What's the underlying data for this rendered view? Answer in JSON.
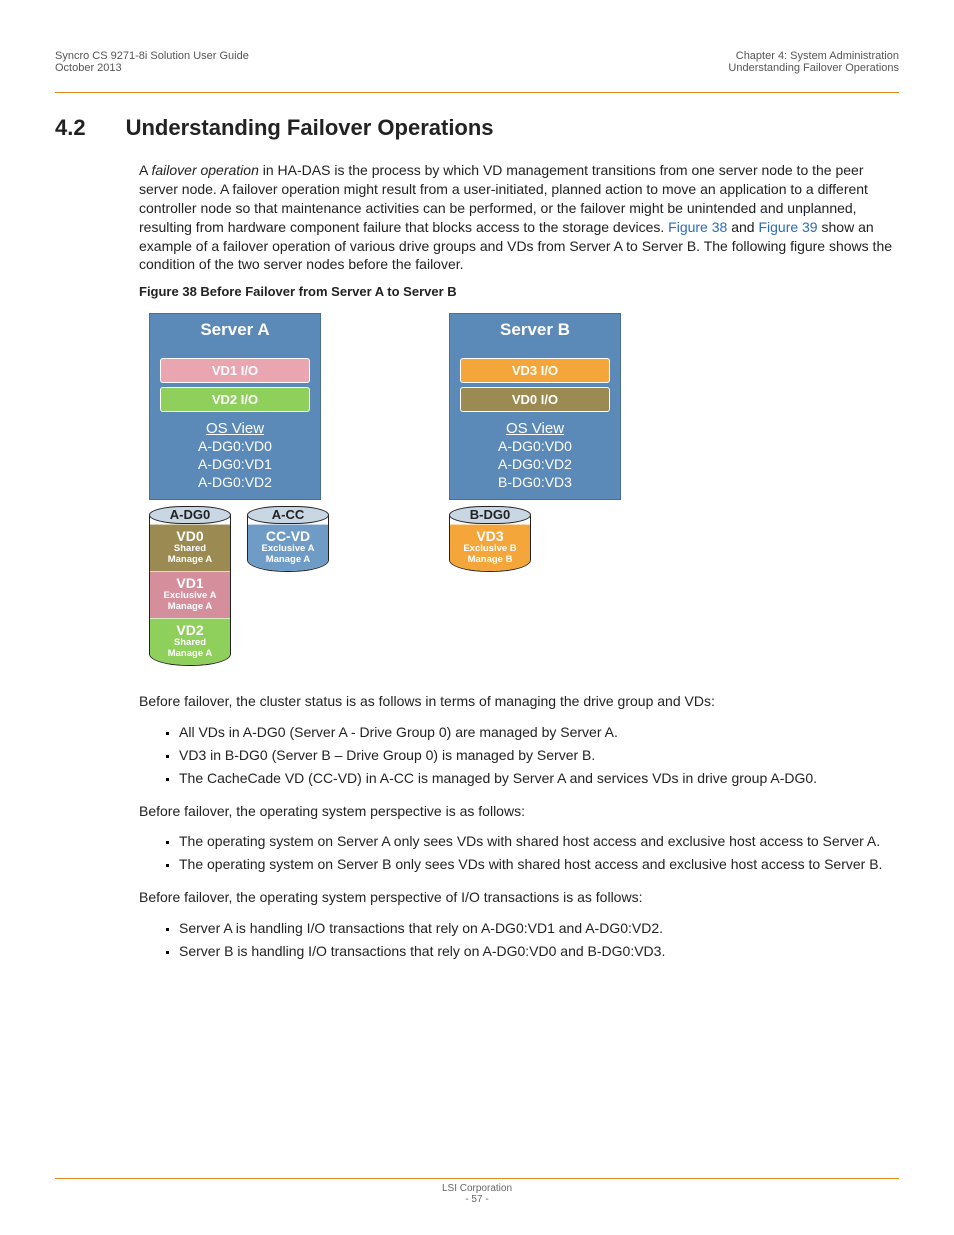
{
  "header": {
    "doc_title": "Syncro CS 9271-8i Solution User Guide",
    "date": "October 2013",
    "chapter": "Chapter 4:  System Administration",
    "subchapter": "Understanding Failover Operations"
  },
  "section": {
    "number": "4.2",
    "title": "Understanding Failover Operations"
  },
  "para1": {
    "lead_a": "A ",
    "ital": "failover operation",
    "body_a": " in HA-DAS is the process by which VD management transitions from one server node to the peer server node. A failover operation might result from a user-initiated, planned action to move an application to a different controller node so that maintenance activities can be performed, or the failover might be unintended and unplanned, resulting from hardware component failure that blocks access to the storage devices. ",
    "link1": "Figure 38",
    "body_b": " and ",
    "link2": "Figure 39",
    "body_c": " show an example of a failover operation of various drive groups and VDs from Server A to Server B. The following figure shows the condition of the two server nodes before the failover."
  },
  "figure_caption": "Figure 38  Before Failover from Server A to Server B",
  "serverA": {
    "title": "Server A",
    "io": [
      "VD1 I/O",
      "VD2 I/O"
    ],
    "os_title": "OS View",
    "os": [
      "A-DG0:VD0",
      "A-DG0:VD1",
      "A-DG0:VD2"
    ]
  },
  "serverB": {
    "title": "Server B",
    "io": [
      "VD3 I/O",
      "VD0 I/O"
    ],
    "os_title": "OS View",
    "os": [
      "A-DG0:VD0",
      "A-DG0:VD2",
      "B-DG0:VD3"
    ]
  },
  "a_dg0": {
    "label": "A-DG0",
    "segs": [
      {
        "name": "VD0",
        "sub1": "Shared",
        "sub2": "Manage A"
      },
      {
        "name": "VD1",
        "sub1": "Exclusive A",
        "sub2": "Manage A"
      },
      {
        "name": "VD2",
        "sub1": "Shared",
        "sub2": "Manage A"
      }
    ]
  },
  "a_cc": {
    "label": "A-CC",
    "seg": {
      "name": "CC-VD",
      "sub1": "Exclusive A",
      "sub2": "Manage A"
    }
  },
  "b_dg0": {
    "label": "B-DG0",
    "seg": {
      "name": "VD3",
      "sub1": "Exclusive B",
      "sub2": "Manage B"
    }
  },
  "p2": "Before failover, the cluster status is as follows in terms of managing the drive group and VDs:",
  "list1": [
    "All VDs in A-DG0 (Server A - Drive Group 0) are managed by Server A.",
    "VD3 in B-DG0 (Server B – Drive Group 0) is managed by Server B.",
    "The CacheCade VD (CC-VD) in A-CC is managed by Server A and services VDs in drive group A-DG0."
  ],
  "p3": "Before failover, the operating system perspective is as follows:",
  "list2": [
    "The operating system on Server A only sees VDs with shared host access and exclusive host access to Server A.",
    "The operating system on Server B only sees VDs with shared host access and exclusive host access to Server B."
  ],
  "p4": "Before failover, the operating system perspective of I/O transactions is as follows:",
  "list3": [
    "Server A is handling I/O transactions that rely on A-DG0:VD1 and A-DG0:VD2.",
    "Server B is handling I/O transactions that rely on A-DG0:VD0 and B-DG0:VD3."
  ],
  "footer": {
    "corp": "LSI Corporation",
    "page": "- 57 -"
  }
}
